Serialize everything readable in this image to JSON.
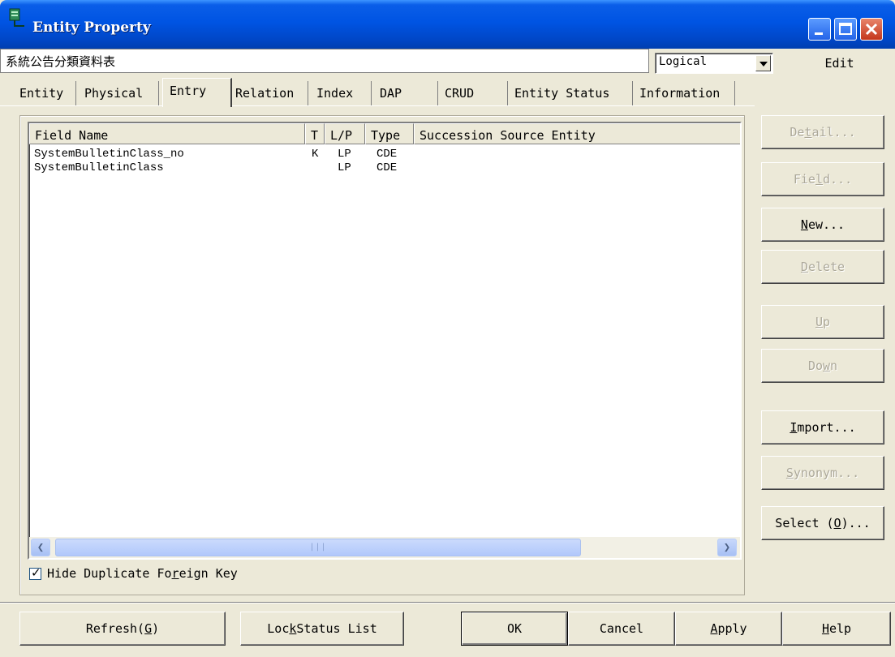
{
  "window": {
    "title": "Entity Property",
    "accent": "#0054e3",
    "controls": [
      "minimize-icon",
      "maximize-icon",
      "close-icon"
    ]
  },
  "entity": {
    "name": "系統公告分類資料表",
    "view_mode": "Logical",
    "edit_label": "Edit"
  },
  "tabs": [
    {
      "label": "Entity",
      "active": false
    },
    {
      "label": "Physical",
      "active": false
    },
    {
      "label": "Entry",
      "active": true
    },
    {
      "label": "Relation",
      "active": false
    },
    {
      "label": "Index",
      "active": false
    },
    {
      "label": "DAP",
      "active": false
    },
    {
      "label": "CRUD",
      "active": false
    },
    {
      "label": "Entity Status",
      "active": false
    },
    {
      "label": "Information",
      "active": false
    }
  ],
  "field_list": {
    "columns": [
      "Field  Name",
      "T",
      "L/P",
      "Type",
      "Succession Source Entity"
    ],
    "rows": [
      {
        "name": "SystemBulletinClass_no",
        "t": "K",
        "lp": "LP",
        "type": "CDE",
        "source": ""
      },
      {
        "name": "SystemBulletinClass",
        "t": "",
        "lp": "LP",
        "type": "CDE",
        "source": ""
      }
    ]
  },
  "options": {
    "hide_duplicate_fk_pre": "Hide Duplicate Fo",
    "hide_duplicate_fk_key": "r",
    "hide_duplicate_fk_post": "eign Key",
    "hide_duplicate_fk_checked": true
  },
  "side_buttons": {
    "detail": {
      "pre": "De",
      "key": "t",
      "post": "ail...",
      "enabled": false
    },
    "field": {
      "pre": "Fie",
      "key": "l",
      "post": "d...",
      "enabled": false
    },
    "new": {
      "pre": "",
      "key": "N",
      "post": "ew...",
      "enabled": true
    },
    "delete": {
      "pre": "",
      "key": "D",
      "post": "elete",
      "enabled": false
    },
    "up": {
      "pre": "",
      "key": "U",
      "post": "p",
      "enabled": false
    },
    "down": {
      "pre": "Do",
      "key": "w",
      "post": "n",
      "enabled": false
    },
    "import": {
      "pre": "",
      "key": "I",
      "post": "mport...",
      "enabled": true
    },
    "synonym": {
      "pre": "",
      "key": "S",
      "post": "ynonym...",
      "enabled": false
    },
    "select": {
      "pre": "Select (",
      "key": "O",
      "post": ")...",
      "enabled": true
    }
  },
  "bottom_buttons": {
    "refresh": {
      "pre": "Refresh(",
      "key": "G",
      "post": ")"
    },
    "lock_status": {
      "pre": "Loc",
      "key": "k",
      "post": " Status List"
    },
    "ok": {
      "pre": "OK",
      "key": "",
      "post": ""
    },
    "cancel": {
      "pre": "Cancel",
      "key": "",
      "post": ""
    },
    "apply": {
      "pre": "",
      "key": "A",
      "post": "pply"
    },
    "help": {
      "pre": "",
      "key": "H",
      "post": "elp"
    }
  }
}
